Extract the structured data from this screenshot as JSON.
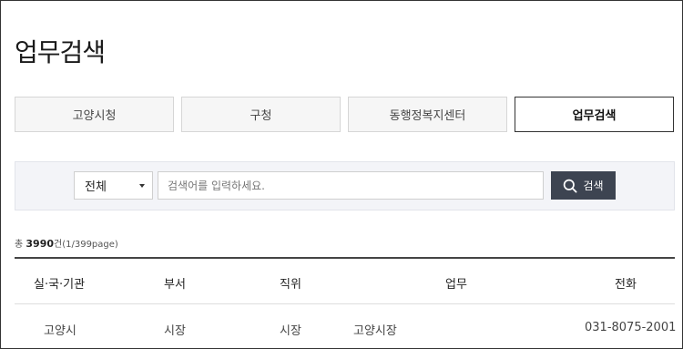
{
  "page": {
    "title": "업무검색"
  },
  "tabs": [
    {
      "label": "고양시청",
      "active": false
    },
    {
      "label": "구청",
      "active": false
    },
    {
      "label": "동행정복지센터",
      "active": false
    },
    {
      "label": "업무검색",
      "active": true
    }
  ],
  "search": {
    "scope_value": "전체",
    "placeholder": "검색어를 입력하세요.",
    "value": "",
    "button_label": "검색",
    "button_icon": "search-icon"
  },
  "results": {
    "prefix": "총",
    "total": "3990",
    "suffix": "건(1/399page)"
  },
  "table": {
    "columns": [
      "실·국·기관",
      "부서",
      "직위",
      "업무",
      "전화"
    ],
    "rows": [
      {
        "org": "고양시",
        "dept": "시장",
        "position": "시장",
        "duty": "고양시장",
        "phone": "031-8075-2001"
      }
    ]
  },
  "colors": {
    "accent_dark": "#3d4451",
    "panel_bg": "#f3f4f8",
    "tab_bg": "#f6f6f6"
  }
}
